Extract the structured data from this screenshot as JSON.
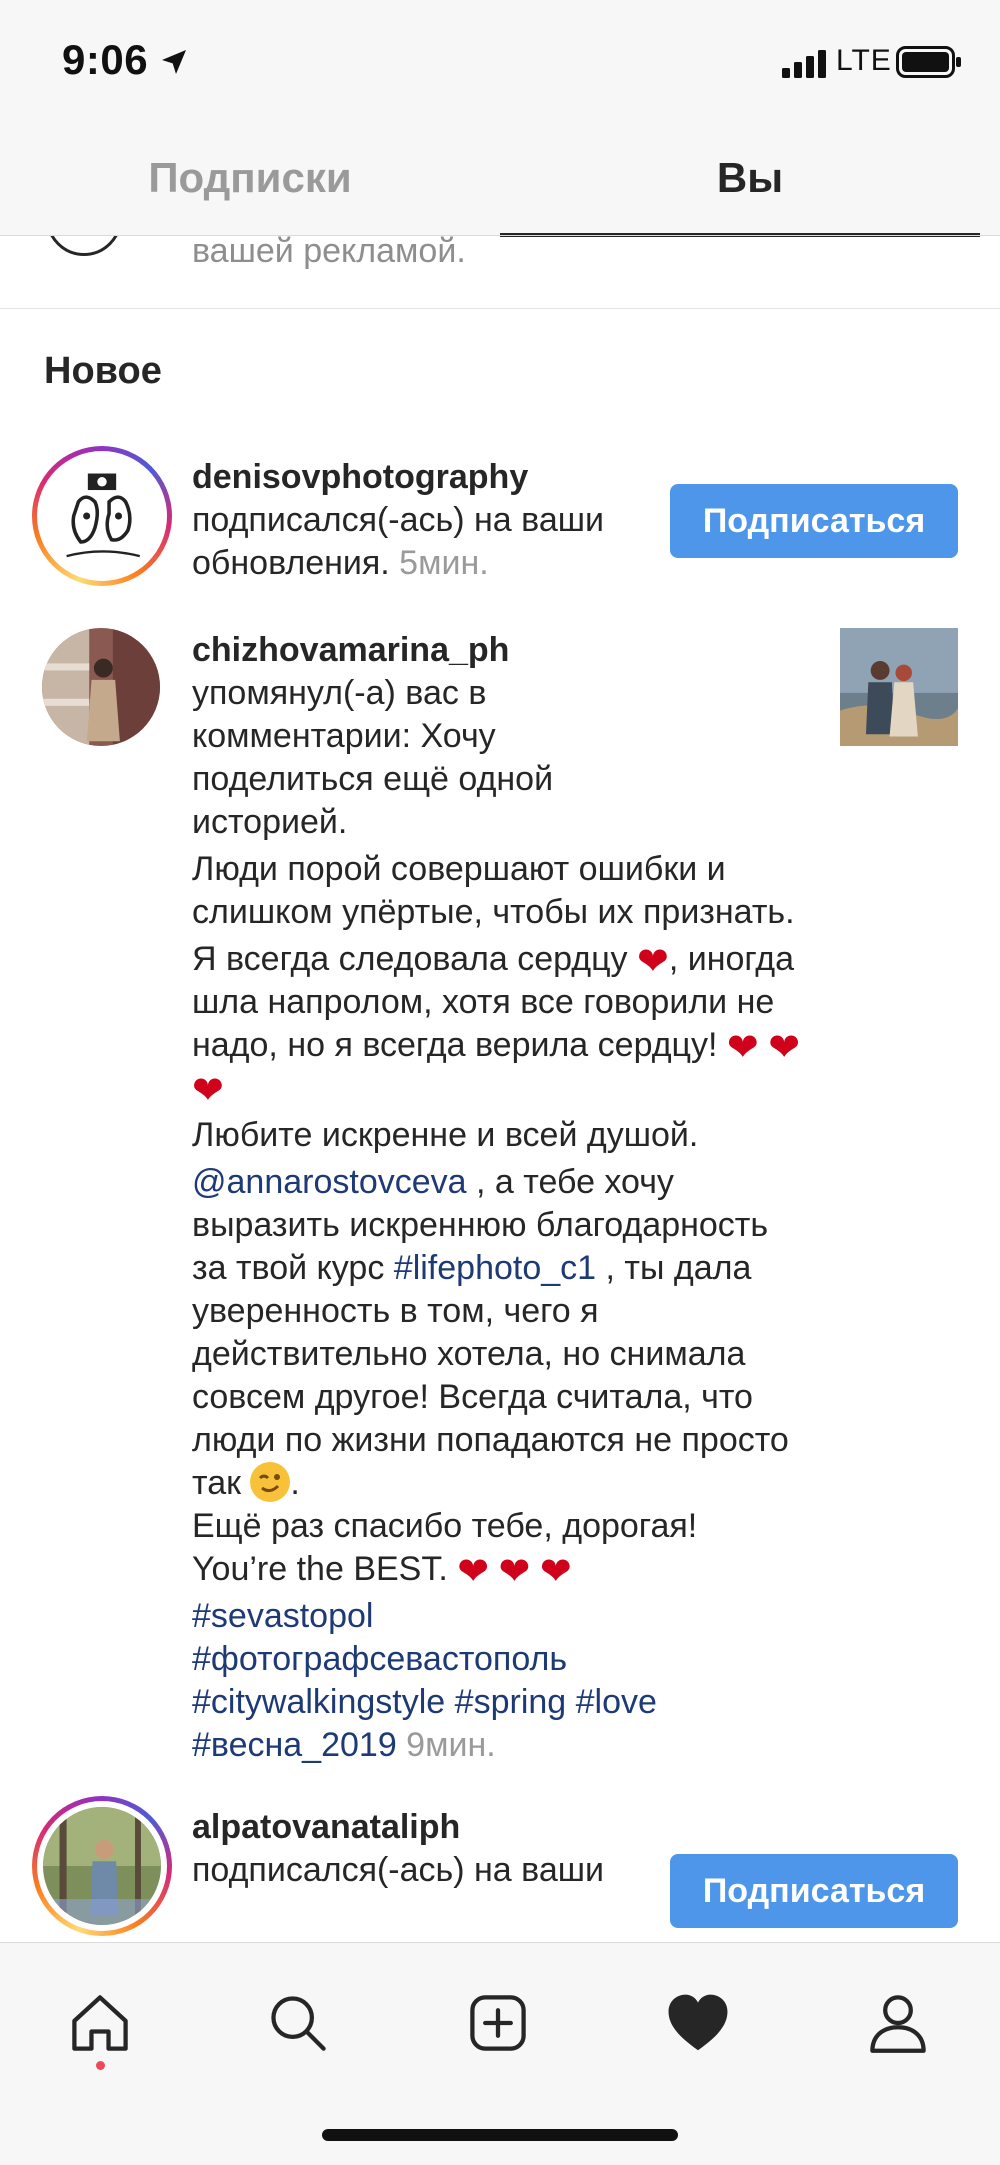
{
  "status_bar": {
    "time": "9:06",
    "network": "LTE",
    "icons": [
      "location-arrow-icon",
      "signal-icon",
      "battery-icon"
    ]
  },
  "tabs": [
    {
      "label": "Подписки",
      "active": false
    },
    {
      "label": "Вы",
      "active": true
    }
  ],
  "partial_row": {
    "text": "вашей рекламой."
  },
  "section": {
    "title": "Новое"
  },
  "notifications": [
    {
      "username": "denisovphotography",
      "action": " подписался(-ась) на ваши обновления.",
      "time": " 5мин.",
      "button_label": "Подписаться"
    },
    {
      "username": "chizhovamarina_ph",
      "intro": " упомянул(-а) вас в комментарии: Хочу поделиться ещё одной историей.",
      "p1": "Люди порой совершают ошибки и слишком упёртые, чтобы их признать.",
      "p2a": "Я всегда следовала сердцу ",
      "p2b": ", иногда шла напролом, хотя все говорили не надо, но я всегда верила сердцу! ",
      "p3": "Любите искренне и всей  душой.",
      "mention": "@annarostovceva",
      "p4a": " , а тебе хочу выразить искреннюю благодарность за твой курс ",
      "hashtag_course": "#lifephoto_c1",
      "p4b": " , ты дала уверенность в том, чего я действительно хотела, но снимала совсем другое! Всегда считала, что люди по жизни попадаются не просто так ",
      "p4c": ".",
      "p5": "Ещё раз спасибо тебе, дорогая!",
      "p6": "You’re the BEST. ",
      "hashtags": [
        "#sevastopol",
        "#фотографсевастополь",
        "#citywalkingstyle",
        "#spring",
        "#love",
        "#весна_2019"
      ],
      "time": " 9мин."
    },
    {
      "username": "alpatovanataliph",
      "action": "подписался(-ась) на ваши",
      "button_label": "Подписаться"
    }
  ],
  "emoji": {
    "heart": "❤",
    "wink": "wink-emoji"
  },
  "bottom_nav": [
    "home-icon",
    "search-icon",
    "new-post-icon",
    "activity-heart-icon",
    "profile-icon"
  ],
  "colors": {
    "follow_button": "#4e96ea",
    "link": "#1e3a76",
    "muted": "#9a9a9a",
    "heart": "#d0021b"
  }
}
